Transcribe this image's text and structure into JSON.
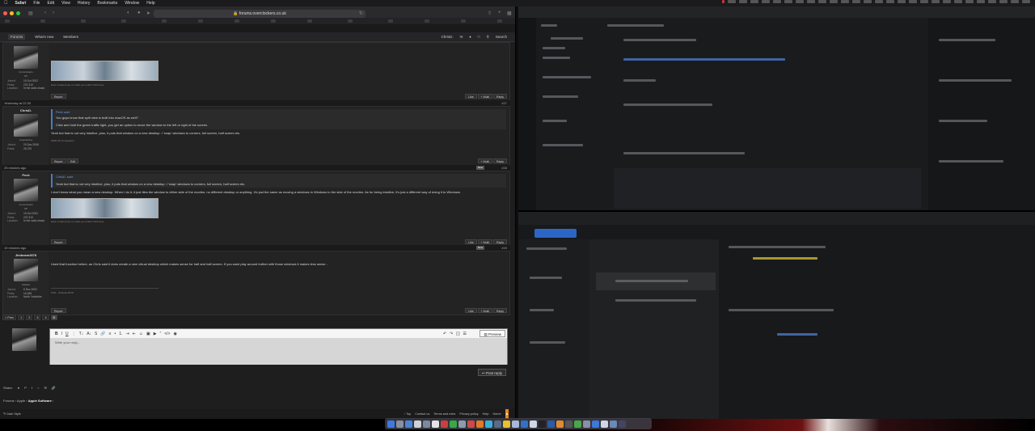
{
  "menubar": {
    "app": "Safari",
    "items": [
      "File",
      "Edit",
      "View",
      "History",
      "Bookmarks",
      "Window",
      "Help"
    ]
  },
  "browser": {
    "url": "forums.overclockers.co.uk"
  },
  "nav": {
    "items": [
      "Forums",
      "What's new",
      "Members"
    ],
    "user": "ChrisD.",
    "search": "Search"
  },
  "posts": [
    {
      "header": "",
      "number": "",
      "user": "",
      "role": "Commissario",
      "rank": "OP",
      "joined": "15 Oct 2002",
      "posts": "237,310",
      "location": "In the radio shack",
      "sig": "Have I helped you or made you smile? Click here",
      "actions": [
        "Like",
        "+ Multi",
        "Reply"
      ],
      "report": "Report"
    },
    {
      "header": "Yesterday at 22:30",
      "number": "#37",
      "user": "ChrisD.",
      "role": "Capodecina",
      "joined": "20 Dec 2006",
      "posts": "26,720",
      "quote_author": "Peek said:",
      "quote_lines": [
        "You guys know that split view is built into macOS as well?",
        "Click and hold the green traffic light, you get an option to move the window to the left or right of the screen."
      ],
      "text": "Yeah but that is not very intuitive, plus, it puts that window on a new desktop. I 'snap' windows to corners, full screen, half screen etc.",
      "sig": "SMW 4G Competition",
      "actions": [
        "+ Multi",
        "Reply"
      ],
      "report": "Report",
      "edit": "Edit"
    },
    {
      "header": "25 minutes ago",
      "new": "New",
      "number": "#38",
      "user": "Peek",
      "role": "Commissario",
      "rank": "OP",
      "joined": "15 Oct 2002",
      "posts": "237,310",
      "location": "In the radio shack",
      "quote_author": "ChrisD. said:",
      "quote_lines": [
        "Yeah but that is not very intuitive, plus, it puts that window on a new desktop. I 'snap' windows to corners, full screen, half screen etc."
      ],
      "text": "I don't know what you mean a new desktop. When I do it, it just tiles the window to either side of the monitor, no different desktop or anything. It's just the same as moving a windows in Windows to the side of the monitor. As for being intuitive, it's just a different way of doing it to Windows.",
      "sig": "Have I helped you or made you smile? Click here",
      "actions": [
        "Like",
        "+ Multi",
        "Reply"
      ],
      "report": "Report"
    },
    {
      "header": "19 minutes ago",
      "new": "New",
      "number": "#39",
      "user": "Jimbeam3678",
      "role": "Soldato",
      "joined": "8 Dec 2002",
      "posts": "16,186",
      "location": "North Yorkshire",
      "text": "Used that function before, as Chris said it does create a new virtual desktop which makes sense for half and half screen. If you want play around further with those windows it makes less sense ..",
      "sig": "PSN - Jimbeam3678",
      "actions": [
        "Like",
        "+ Multi",
        "Reply"
      ],
      "report": "Report"
    }
  ],
  "labels": {
    "joined": "Joined:",
    "posts": "Posts:",
    "location": "Location:"
  },
  "pager": [
    "< Prev",
    "1",
    "2",
    "3",
    "4",
    "5"
  ],
  "editor": {
    "placeholder": "Write your reply...",
    "preview": "Preview",
    "post_reply": "Post reply"
  },
  "share": {
    "label": "Share:"
  },
  "breadcrumb": {
    "items": [
      "Forums",
      "Apple"
    ],
    "current": "Apple Software"
  },
  "footer": {
    "style": "Dark Style",
    "links": [
      "Top",
      "Contact us",
      "Terms and rules",
      "Privacy policy",
      "Help",
      "Home"
    ]
  }
}
